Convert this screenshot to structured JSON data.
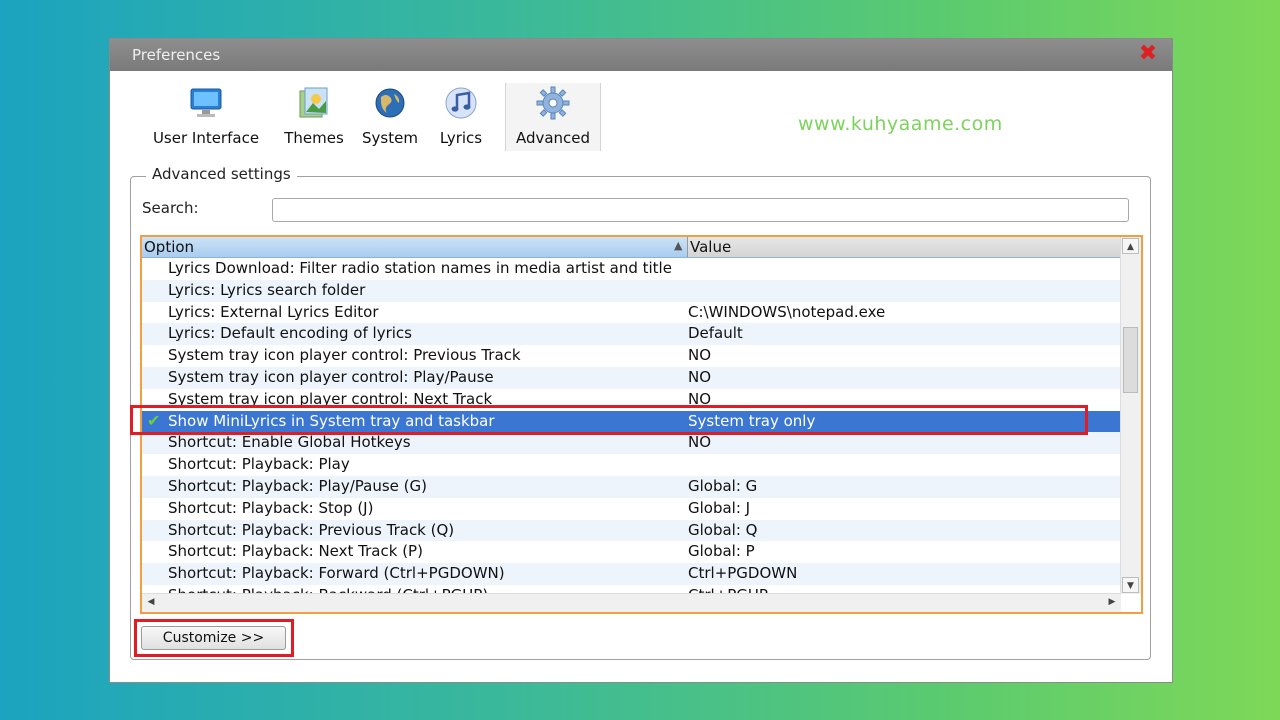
{
  "window": {
    "title": "Preferences"
  },
  "toolbar": {
    "tabs": [
      {
        "label": "User Interface",
        "icon": "monitor-icon"
      },
      {
        "label": "Themes",
        "icon": "themes-folder-icon"
      },
      {
        "label": "System",
        "icon": "globe-icon"
      },
      {
        "label": "Lyrics",
        "icon": "music-note-icon"
      },
      {
        "label": "Advanced",
        "icon": "gear-icon",
        "active": true
      }
    ]
  },
  "watermark": "www.kuhyaame.com",
  "advanced": {
    "group_label": "Advanced settings",
    "search_label": "Search:",
    "search_value": "",
    "columns": {
      "option": "Option",
      "value": "Value"
    },
    "rows": [
      {
        "option": "Lyrics Download: Filter radio station names in media artist and title",
        "value": ""
      },
      {
        "option": "Lyrics: Lyrics search folder",
        "value": ""
      },
      {
        "option": "Lyrics: External Lyrics Editor",
        "value": "C:\\WINDOWS\\notepad.exe"
      },
      {
        "option": "Lyrics: Default encoding of lyrics",
        "value": "Default"
      },
      {
        "option": "System tray icon player control: Previous Track",
        "value": "NO"
      },
      {
        "option": "System tray icon player control: Play/Pause",
        "value": "NO"
      },
      {
        "option": "System tray icon player control: Next Track",
        "value": "NO"
      },
      {
        "option": "Show MiniLyrics in System tray and taskbar",
        "value": "System tray only",
        "selected": true
      },
      {
        "option": "Shortcut: Enable Global Hotkeys",
        "value": "NO"
      },
      {
        "option": "Shortcut: Playback: Play",
        "value": ""
      },
      {
        "option": "Shortcut: Playback: Play/Pause (G)",
        "value": "Global: G"
      },
      {
        "option": "Shortcut: Playback: Stop (J)",
        "value": "Global: J"
      },
      {
        "option": "Shortcut: Playback: Previous Track (Q)",
        "value": "Global: Q"
      },
      {
        "option": "Shortcut: Playback: Next Track (P)",
        "value": "Global: P"
      },
      {
        "option": "Shortcut: Playback: Forward (Ctrl+PGDOWN)",
        "value": "Ctrl+PGDOWN"
      },
      {
        "option": "Shortcut: Playback: Backward (Ctrl+PGUP)",
        "value": "Ctrl+PGUP"
      }
    ]
  },
  "customize_label": "Customize >>",
  "colors": {
    "highlight": "#e01c24",
    "selection": "#3a76d2",
    "focus_border": "#f0a040"
  }
}
